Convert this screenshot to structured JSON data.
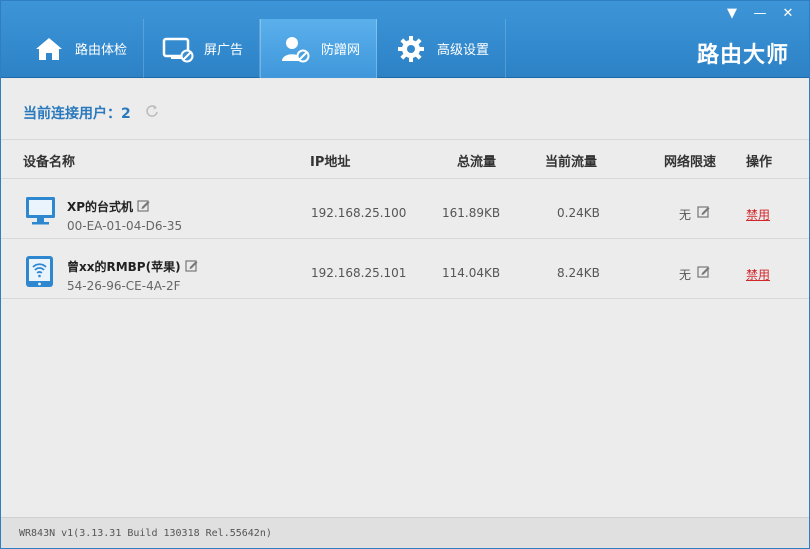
{
  "window": {
    "controls": [
      "▼",
      "—",
      "✕"
    ]
  },
  "tabs": [
    {
      "label": "路由体检",
      "icon": "home-icon",
      "active": false
    },
    {
      "label": "屏广告",
      "icon": "monitor-block-icon",
      "active": false
    },
    {
      "label": "防蹭网",
      "icon": "user-shield-icon",
      "active": true
    },
    {
      "label": "高级设置",
      "icon": "gear-icon",
      "active": false
    }
  ],
  "brand": "路由大师",
  "summary": {
    "label": "当前连接用户：2"
  },
  "table": {
    "headers": {
      "device": "设备名称",
      "ip": "IP地址",
      "total": "总流量",
      "current": "当前流量",
      "limit": "网络限速",
      "action": "操作"
    },
    "rows": [
      {
        "icon": "desktop-icon",
        "name": "XP的台式机",
        "mac": "00-EA-01-04-D6-35",
        "ip": "192.168.25.100",
        "total": "161.89KB",
        "current": "0.24KB",
        "limit": "无",
        "action": "禁用"
      },
      {
        "icon": "tablet-wifi-icon",
        "name": "曾xx的RMBP(苹果)",
        "mac": "54-26-96-CE-4A-2F",
        "ip": "192.168.25.101",
        "total": "114.04KB",
        "current": "8.24KB",
        "limit": "无",
        "action": "禁用"
      }
    ]
  },
  "footer": {
    "version": "WR843N v1(3.13.31 Build 130318 Rel.55642n)"
  },
  "colors": {
    "accent": "#2d82c6",
    "link_red": "#d0272b",
    "title_blue": "#2a79bc"
  }
}
